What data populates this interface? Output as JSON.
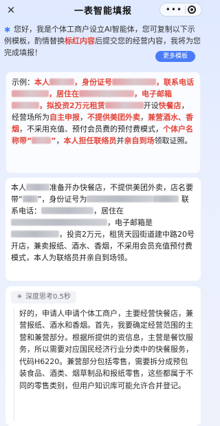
{
  "nav": {
    "title": "一表智能填报",
    "close_icon": "×",
    "more_icon": "•••",
    "target_icon": "target-icon"
  },
  "intro": {
    "text_a": "您好，我是个体工商户设立AI智能体，您可复制以下示例模板，酌情替换",
    "highlight": "标红内容",
    "text_b": "后提交您的经营内容，我将为您完成填报！",
    "more_button": "更多模板"
  },
  "example": {
    "label": "示例：",
    "p1": "本人",
    "p2": "，身份证号",
    "p3": "，联系电话",
    "p4": "，居住在",
    "p5": "，电子邮箱",
    "p6": "，拟投资2万元租赁",
    "p7": "开设",
    "biz": "快餐店",
    "p8": "，经营场所为",
    "self_report": "自主申报",
    "p9": "，",
    "no_takeout": "不提供美团外卖",
    "p10": "，",
    "also_sell": "兼营酒水、香烟",
    "p11": "，不采用充值、预付会员费的预付费模式，",
    "name_rule": "个体户名称带“",
    "name_rule_end": "”",
    "p12": "，",
    "liaison": "本人担任联络员",
    "p13": "并",
    "onsite": "亲自到场",
    "p14": "领取证照。"
  },
  "user_msg": {
    "a": "本人",
    "b": "准备开办快餐店，不提供美团外卖，店名要带“",
    "c": "”，身份证号为",
    "d": "联系电话：",
    "e": "，居住在",
    "f": "，电子邮箱是",
    "g": "，投资2万元，租赁天园街道建中路20号开店，兼卖报纸、酒水、香烟，不采用会员充值预付费模式，本人为联络员并亲自到场领。"
  },
  "reply": {
    "think_label": "深度思考0.5秒",
    "text": "好的，申请人申请个体工商户，主要经营快餐店，兼营报纸、酒水和香烟。首先，我要确定经营范围的主营和兼营部分。根据所提供的资信息，主营是餐饮服务，所以需要对应国民经济行业分类中的快餐服务，代码H6220。兼营部分包括零售，需要拆分成预包装食品、酒类、烟草制品和报纸零售，这些都属于不同的零售类别，但用户知识库可能允许合并登记。"
  }
}
